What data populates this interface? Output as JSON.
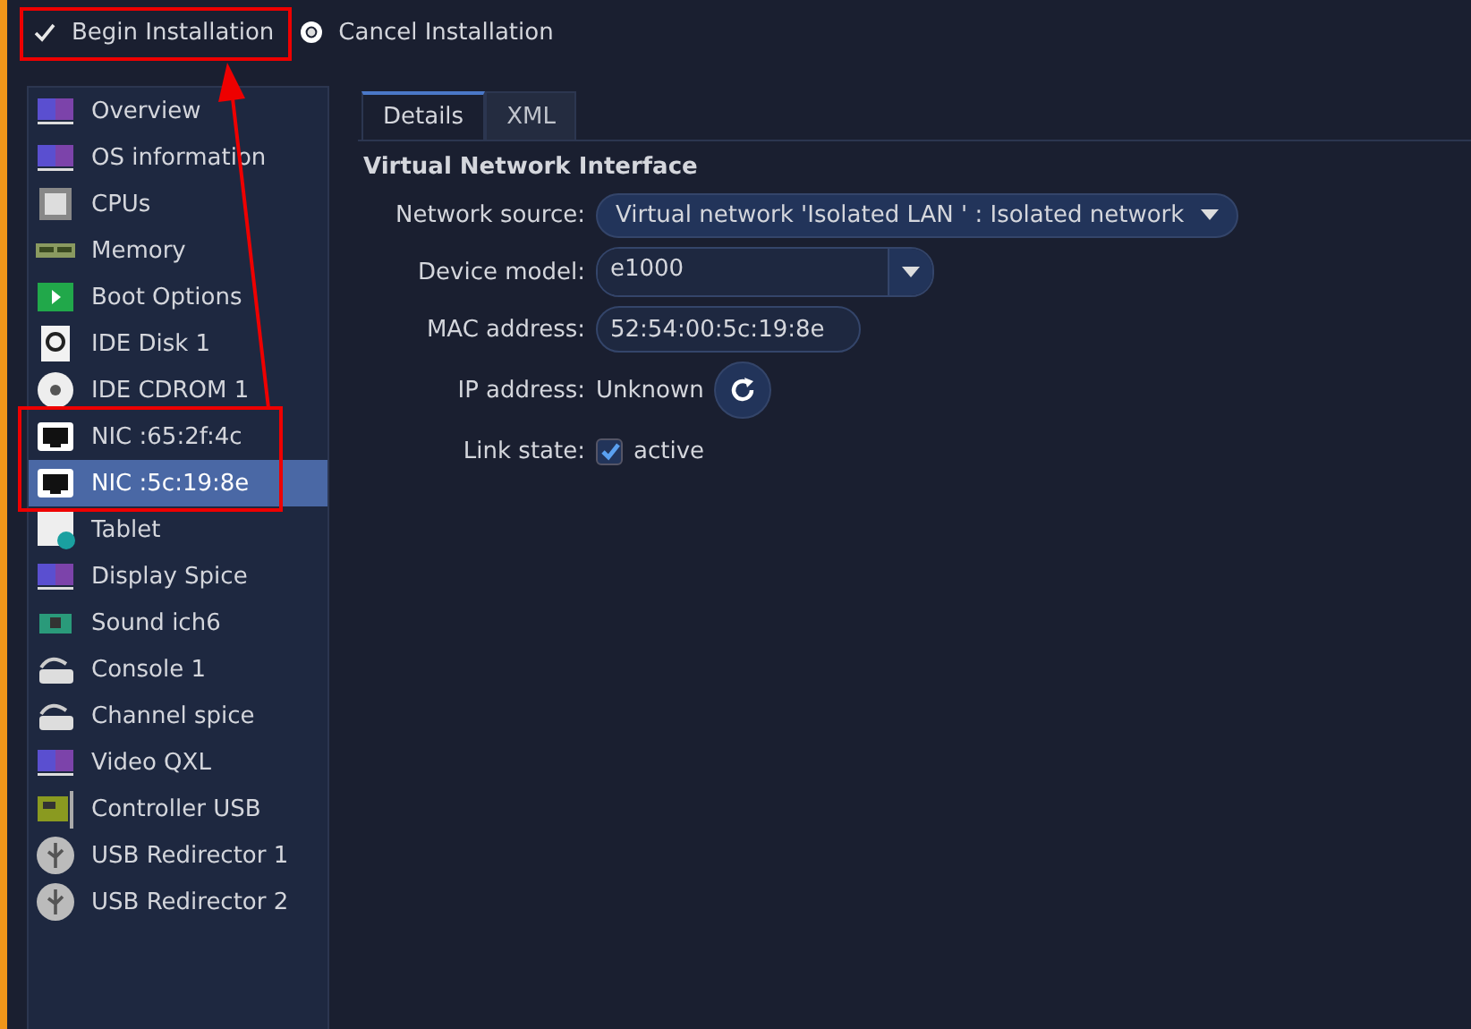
{
  "toolbar": {
    "begin": {
      "label": "Begin Installation"
    },
    "cancel": {
      "label": "Cancel Installation"
    }
  },
  "sidebar": {
    "items": [
      {
        "label": "Overview",
        "kind": "monitor",
        "selected": false
      },
      {
        "label": "OS information",
        "kind": "monitor",
        "selected": false
      },
      {
        "label": "CPUs",
        "kind": "chip",
        "selected": false
      },
      {
        "label": "Memory",
        "kind": "memory",
        "selected": false
      },
      {
        "label": "Boot Options",
        "kind": "boot",
        "selected": false
      },
      {
        "label": "IDE Disk 1",
        "kind": "disk",
        "selected": false
      },
      {
        "label": "IDE CDROM 1",
        "kind": "cdrom",
        "selected": false
      },
      {
        "label": "NIC :65:2f:4c",
        "kind": "nic",
        "selected": false
      },
      {
        "label": "NIC :5c:19:8e",
        "kind": "nic",
        "selected": true
      },
      {
        "label": "Tablet",
        "kind": "tablet",
        "selected": false
      },
      {
        "label": "Display Spice",
        "kind": "display",
        "selected": false
      },
      {
        "label": "Sound ich6",
        "kind": "sound",
        "selected": false
      },
      {
        "label": "Console 1",
        "kind": "serial",
        "selected": false
      },
      {
        "label": "Channel spice",
        "kind": "serial",
        "selected": false
      },
      {
        "label": "Video QXL",
        "kind": "display",
        "selected": false
      },
      {
        "label": "Controller USB",
        "kind": "card",
        "selected": false
      },
      {
        "label": "USB Redirector 1",
        "kind": "usb",
        "selected": false
      },
      {
        "label": "USB Redirector 2",
        "kind": "usb",
        "selected": false
      }
    ]
  },
  "tabs": [
    {
      "label": "Details",
      "selected": true
    },
    {
      "label": "XML",
      "selected": false
    }
  ],
  "section_title": "Virtual Network Interface",
  "fields": [
    {
      "kind": "combo",
      "label": "Network source:",
      "value": "Virtual network 'Isolated LAN ' : Isolated network"
    },
    {
      "kind": "dropdown",
      "label": "Device model:",
      "value": "e1000"
    },
    {
      "kind": "entry",
      "label": "MAC address:",
      "value": "52:54:00:5c:19:8e"
    },
    {
      "kind": "refresh",
      "label": "IP address:",
      "value": "Unknown"
    },
    {
      "kind": "check",
      "label": "Link state:",
      "value": "active",
      "checked": true
    }
  ]
}
